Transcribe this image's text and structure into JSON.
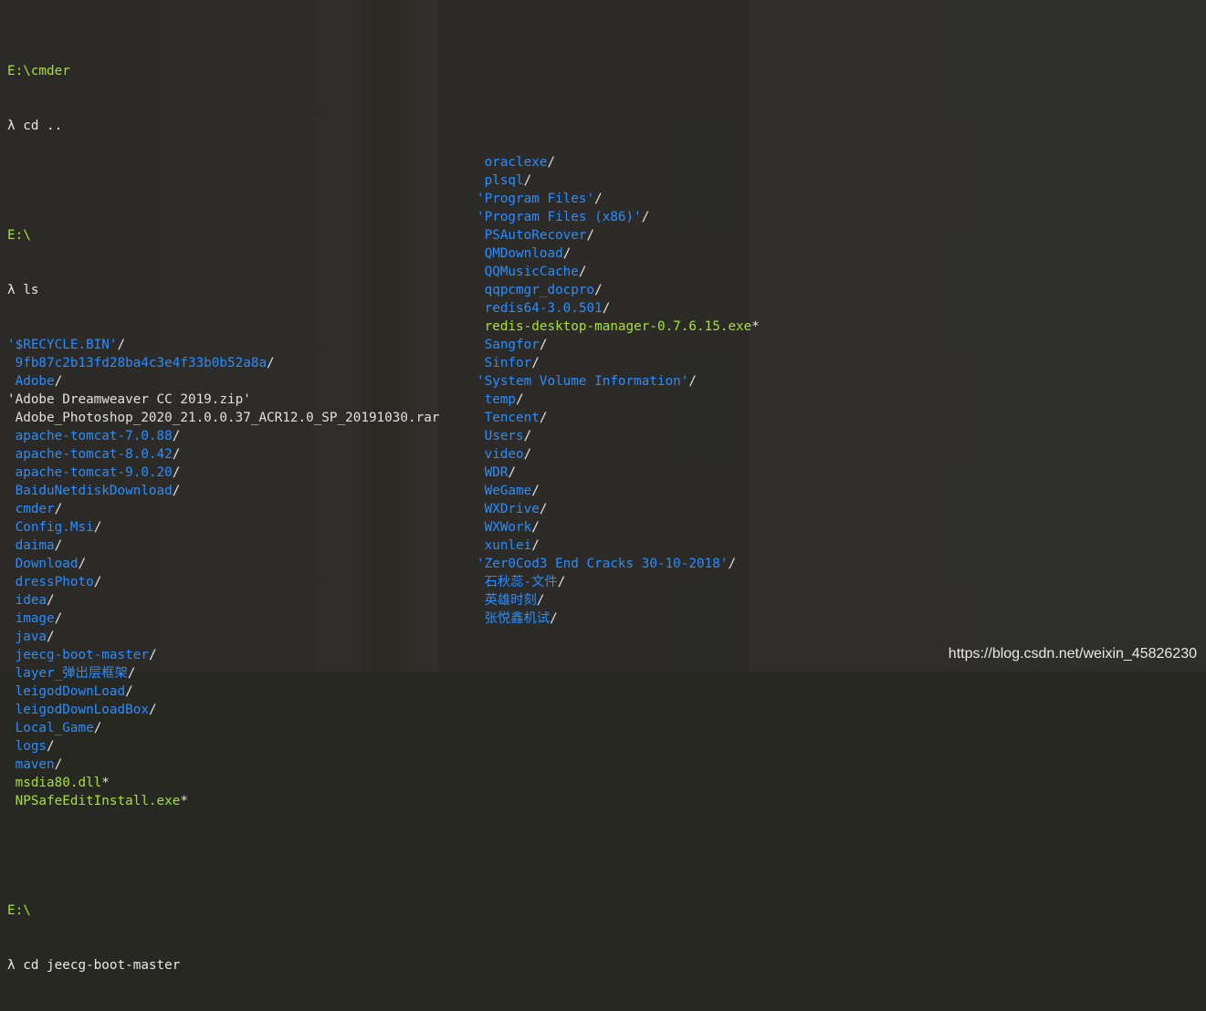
{
  "session": {
    "prompt1_path": "E:\\cmder",
    "prompt1_cmd": "λ cd ..",
    "prompt2_path": "E:\\",
    "prompt2_cmd": "λ ls",
    "prompt3_path": "E:\\",
    "prompt3_cmd": "λ cd jeecg-boot-master"
  },
  "listing_left": [
    {
      "name": "'$RECYCLE.BIN'",
      "suffix": "/",
      "type": "dir"
    },
    {
      "name": " 9fb87c2b13fd28ba4c3e4f33b0b52a8a",
      "suffix": "/",
      "type": "dir"
    },
    {
      "name": " Adobe",
      "suffix": "/",
      "type": "dir"
    },
    {
      "name": "'Adobe Dreamweaver CC 2019.zip'",
      "suffix": "",
      "type": "file"
    },
    {
      "name": " Adobe_Photoshop_2020_21.0.0.37_ACR12.0_SP_20191030.rar",
      "suffix": "",
      "type": "file"
    },
    {
      "name": " apache-tomcat-7.0.88",
      "suffix": "/",
      "type": "dir"
    },
    {
      "name": " apache-tomcat-8.0.42",
      "suffix": "/",
      "type": "dir"
    },
    {
      "name": " apache-tomcat-9.0.20",
      "suffix": "/",
      "type": "dir"
    },
    {
      "name": " BaiduNetdiskDownload",
      "suffix": "/",
      "type": "dir"
    },
    {
      "name": " cmder",
      "suffix": "/",
      "type": "dir"
    },
    {
      "name": " Config.Msi",
      "suffix": "/",
      "type": "dir"
    },
    {
      "name": " daima",
      "suffix": "/",
      "type": "dir"
    },
    {
      "name": " Download",
      "suffix": "/",
      "type": "dir"
    },
    {
      "name": " dressPhoto",
      "suffix": "/",
      "type": "dir"
    },
    {
      "name": " idea",
      "suffix": "/",
      "type": "dir"
    },
    {
      "name": " image",
      "suffix": "/",
      "type": "dir"
    },
    {
      "name": " java",
      "suffix": "/",
      "type": "dir"
    },
    {
      "name": " jeecg-boot-master",
      "suffix": "/",
      "type": "dir"
    },
    {
      "name": " layer_弹出层框架",
      "suffix": "/",
      "type": "dir"
    },
    {
      "name": " leigodDownLoad",
      "suffix": "/",
      "type": "dir"
    },
    {
      "name": " leigodDownLoadBox",
      "suffix": "/",
      "type": "dir"
    },
    {
      "name": " Local_Game",
      "suffix": "/",
      "type": "dir"
    },
    {
      "name": " logs",
      "suffix": "/",
      "type": "dir"
    },
    {
      "name": " maven",
      "suffix": "/",
      "type": "dir"
    },
    {
      "name": " msdia80.dll",
      "suffix": "*",
      "type": "exe"
    },
    {
      "name": " NPSafeEditInstall.exe",
      "suffix": "*",
      "type": "exe"
    }
  ],
  "listing_right": [
    {
      "name": " oraclexe",
      "suffix": "/",
      "type": "dir"
    },
    {
      "name": " plsql",
      "suffix": "/",
      "type": "dir"
    },
    {
      "name": "'Program Files'",
      "suffix": "/",
      "type": "dir"
    },
    {
      "name": "'Program Files (x86)'",
      "suffix": "/",
      "type": "dir"
    },
    {
      "name": " PSAutoRecover",
      "suffix": "/",
      "type": "dir"
    },
    {
      "name": " QMDownload",
      "suffix": "/",
      "type": "dir"
    },
    {
      "name": " QQMusicCache",
      "suffix": "/",
      "type": "dir"
    },
    {
      "name": " qqpcmgr_docpro",
      "suffix": "/",
      "type": "dir"
    },
    {
      "name": " redis64-3.0.501",
      "suffix": "/",
      "type": "dir"
    },
    {
      "name": " redis-desktop-manager-0.7.6.15.exe",
      "suffix": "*",
      "type": "exe"
    },
    {
      "name": " Sangfor",
      "suffix": "/",
      "type": "dir"
    },
    {
      "name": " Sinfor",
      "suffix": "/",
      "type": "dir"
    },
    {
      "name": "'System Volume Information'",
      "suffix": "/",
      "type": "dir"
    },
    {
      "name": " temp",
      "suffix": "/",
      "type": "dir"
    },
    {
      "name": " Tencent",
      "suffix": "/",
      "type": "dir"
    },
    {
      "name": " Users",
      "suffix": "/",
      "type": "dir"
    },
    {
      "name": " video",
      "suffix": "/",
      "type": "dir"
    },
    {
      "name": " WDR",
      "suffix": "/",
      "type": "dir"
    },
    {
      "name": " WeGame",
      "suffix": "/",
      "type": "dir"
    },
    {
      "name": " WXDrive",
      "suffix": "/",
      "type": "dir"
    },
    {
      "name": " WXWork",
      "suffix": "/",
      "type": "dir"
    },
    {
      "name": " xunlei",
      "suffix": "/",
      "type": "dir"
    },
    {
      "name": "'Zer0Cod3 End Cracks 30-10-2018'",
      "suffix": "/",
      "type": "dir"
    },
    {
      "name": " 石秋蕊-文件",
      "suffix": "/",
      "type": "dir"
    },
    {
      "name": " 英雄时刻",
      "suffix": "/",
      "type": "dir"
    },
    {
      "name": " 张悦鑫机试",
      "suffix": "/",
      "type": "dir"
    }
  ],
  "watermark": "https://blog.csdn.net/weixin_45826230",
  "colors": {
    "background": "#272822",
    "prompt": "#a6e22e",
    "directory": "#2a8dff",
    "executable": "#a6e22e",
    "text": "#e0e0e0"
  }
}
